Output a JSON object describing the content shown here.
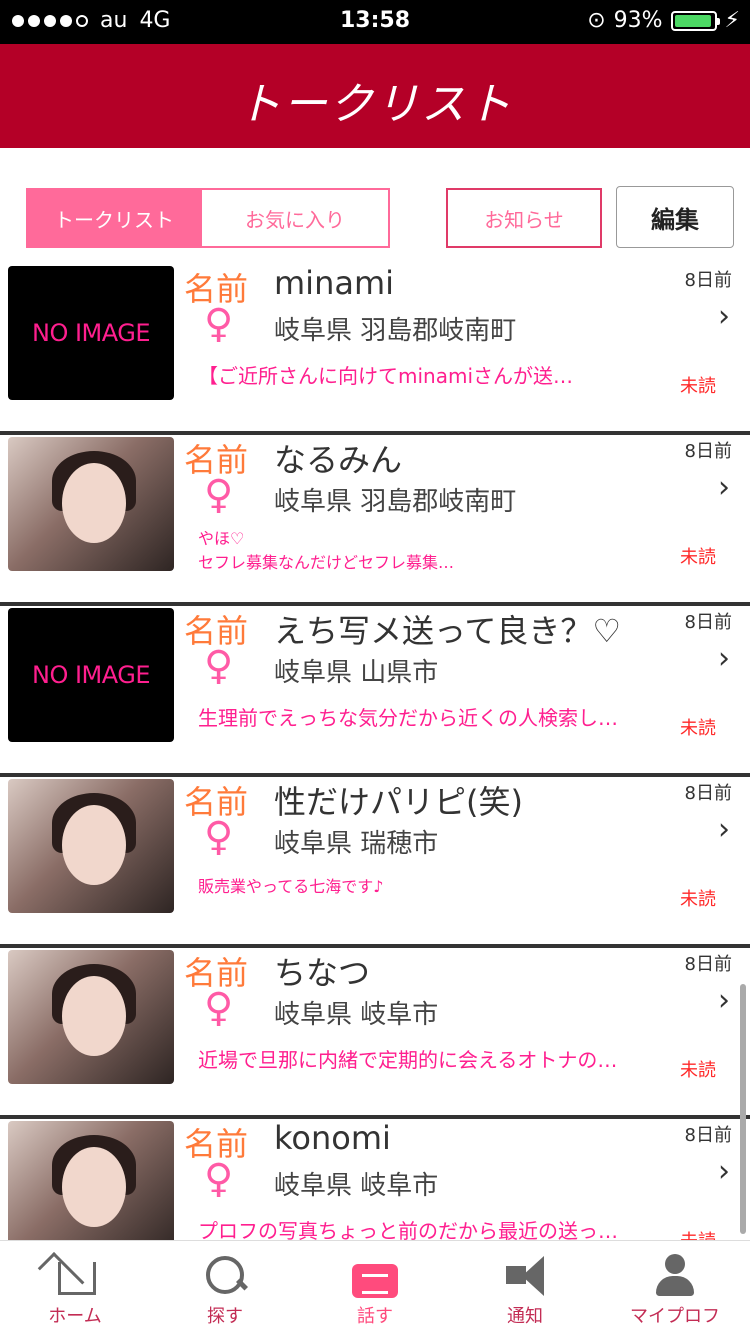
{
  "status": {
    "carrier": "au",
    "network": "4G",
    "time": "13:58",
    "battery": "93%",
    "battery_level": 0.93
  },
  "header": {
    "title": "トークリスト"
  },
  "tabs": [
    {
      "label": "トークリスト"
    },
    {
      "label": "お気に入り"
    }
  ],
  "buttons": {
    "notify": "お知らせ",
    "edit": "編集"
  },
  "common": {
    "name_label": "名前",
    "gender_symbol": "♀",
    "unread": "未読",
    "chevron": "›"
  },
  "items": [
    {
      "name": "minami",
      "location": "岐阜県 羽島郡岐南町",
      "message": "【ご近所さんに向けてminamiさんが送…",
      "days": "8日前",
      "image": "NO IMAGE"
    },
    {
      "name": "なるみん",
      "location": "岐阜県 羽島郡岐南町",
      "message": "やほ♡\nセフレ募集なんだけどセフレ募集…",
      "days": "8日前"
    },
    {
      "name": "えち写メ送って良き？♡",
      "location": "岐阜県 山県市",
      "message": "生理前でえっちな気分だから近くの人検索し…",
      "days": "8日前",
      "image": "NO IMAGE"
    },
    {
      "name": "性だけパリピ(笑)",
      "location": "岐阜県 瑞穂市",
      "message": "販売業やってる七海です♪",
      "days": "8日前"
    },
    {
      "name": "ちなつ",
      "location": "岐阜県 岐阜市",
      "message": "近場で旦那に内緒で定期的に会えるオトナの…",
      "days": "8日前"
    },
    {
      "name": "konomi",
      "location": "岐阜県 岐阜市",
      "message": "プロフの写真ちょっと前のだから最近の送っ…",
      "days": "8日前"
    }
  ],
  "tabbar": [
    {
      "label": "ホーム",
      "icon": "home-icon"
    },
    {
      "label": "探す",
      "icon": "search-icon"
    },
    {
      "label": "話す",
      "icon": "chat-icon"
    },
    {
      "label": "通知",
      "icon": "megaphone-icon"
    },
    {
      "label": "マイプロフ",
      "icon": "user-icon"
    }
  ]
}
